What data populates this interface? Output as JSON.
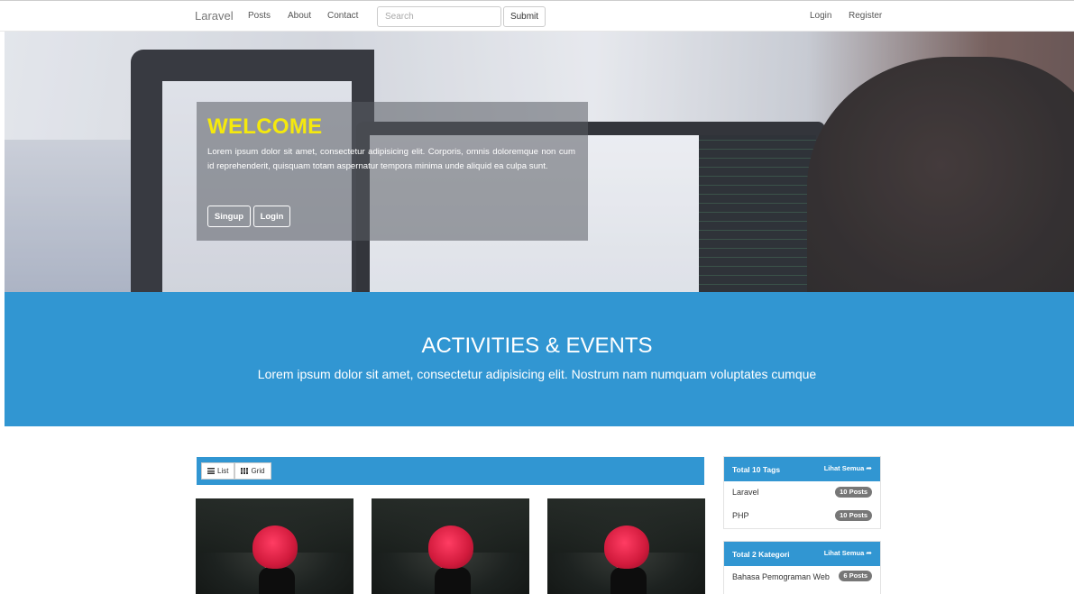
{
  "navbar": {
    "brand": "Laravel",
    "links": [
      "Posts",
      "About",
      "Contact"
    ],
    "search_placeholder": "Search",
    "submit_label": "Submit",
    "auth_links": [
      "Login",
      "Register"
    ]
  },
  "hero": {
    "title": "WELCOME",
    "text": "Lorem ipsum dolor sit amet, consectetur adipisicing elit. Corporis, omnis doloremque non cum id reprehenderit, quisquam totam aspernatur tempora minima unde aliquid ea culpa sunt.",
    "signup_label": "Singup",
    "login_label": "Login",
    "title_color": "#f5e90d"
  },
  "banner": {
    "title": "ACTIVITIES & EVENTS",
    "subtitle": "Lorem ipsum dolor sit amet, consectetur adipisicing elit. Nostrum nam numquam voluptates cumque",
    "color": "#3196d2"
  },
  "toolbar": {
    "list_label": "List",
    "grid_label": "Grid"
  },
  "tags_panel": {
    "title": "Total 10 Tags",
    "link": "Lihat Semua",
    "items": [
      {
        "label": "Laravel",
        "badge": "10 Posts"
      },
      {
        "label": "PHP",
        "badge": "10 Posts"
      }
    ]
  },
  "kategori_panel": {
    "title": "Total 2 Kategori",
    "link": "Lihat Semua",
    "items": [
      {
        "label": "Bahasa Pemograman Web",
        "badge": "6 Posts"
      }
    ]
  },
  "icons": [
    "list-icon",
    "grid-icon",
    "share-icon"
  ]
}
